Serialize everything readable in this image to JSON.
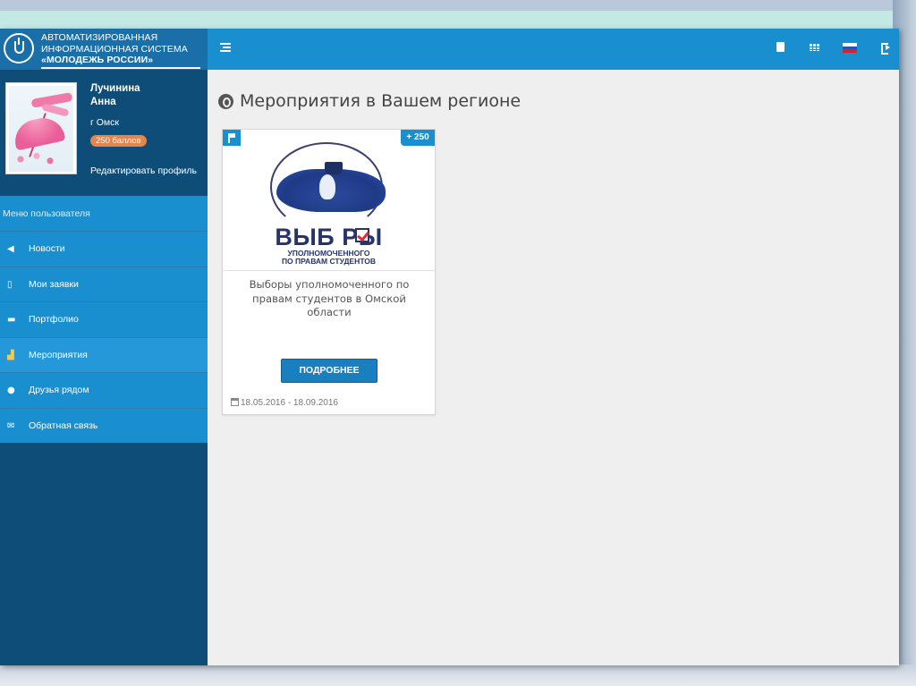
{
  "brand": {
    "line1": "АВТОМАТИЗИРОВАННАЯ",
    "line2": "ИНФОРМАЦИОННАЯ СИСТЕМА",
    "line3": "«МОЛОДЕЖЬ РОССИИ»"
  },
  "header": {
    "icons": [
      "menu-icon",
      "document-icon",
      "grid-icon",
      "russian-flag-icon",
      "logout-icon"
    ],
    "flag_colors": [
      "#ffffff",
      "#2753b5",
      "#d4222f"
    ]
  },
  "profile": {
    "first_line": "Лучинина",
    "second_line": "Анна",
    "city": "г Омск",
    "points_badge": "250 баллов",
    "edit_link": "Редактировать профиль"
  },
  "menu": {
    "header": "Меню пользователя",
    "items": [
      {
        "label": "Новости",
        "icon": "megaphone-icon",
        "glyph": "📢"
      },
      {
        "label": "Мои заявки",
        "icon": "bookmark-icon",
        "glyph": "🔖"
      },
      {
        "label": "Портфолио",
        "icon": "folder-icon",
        "glyph": "📂"
      },
      {
        "label": "Мероприятия",
        "icon": "events-icon",
        "glyph": "🏰"
      },
      {
        "label": "Друзья рядом",
        "icon": "map-pin-icon",
        "glyph": "📍"
      },
      {
        "label": "Обратная связь",
        "icon": "envelope-icon",
        "glyph": "✉"
      }
    ]
  },
  "content": {
    "title": "Мероприятия в Вашем регионе",
    "cards": [
      {
        "points": "+ 250",
        "logo_title": "ВЫБ  РЫ",
        "logo_sub1": "УПОЛНОМОЧЕННОГО",
        "logo_sub2": "ПО ПРАВАМ СТУДЕНТОВ",
        "title": "Выборы уполномоченного по правам студентов в Омской области",
        "button": "ПОДРОБНЕЕ",
        "dates": "18.05.2016 - 18.09.2016"
      }
    ]
  },
  "colors": {
    "header_blue": "#1a8fd0",
    "sidebar_dark": "#0e4d78",
    "badge_orange": "#e9834a",
    "button_blue": "#1a7fbf"
  }
}
